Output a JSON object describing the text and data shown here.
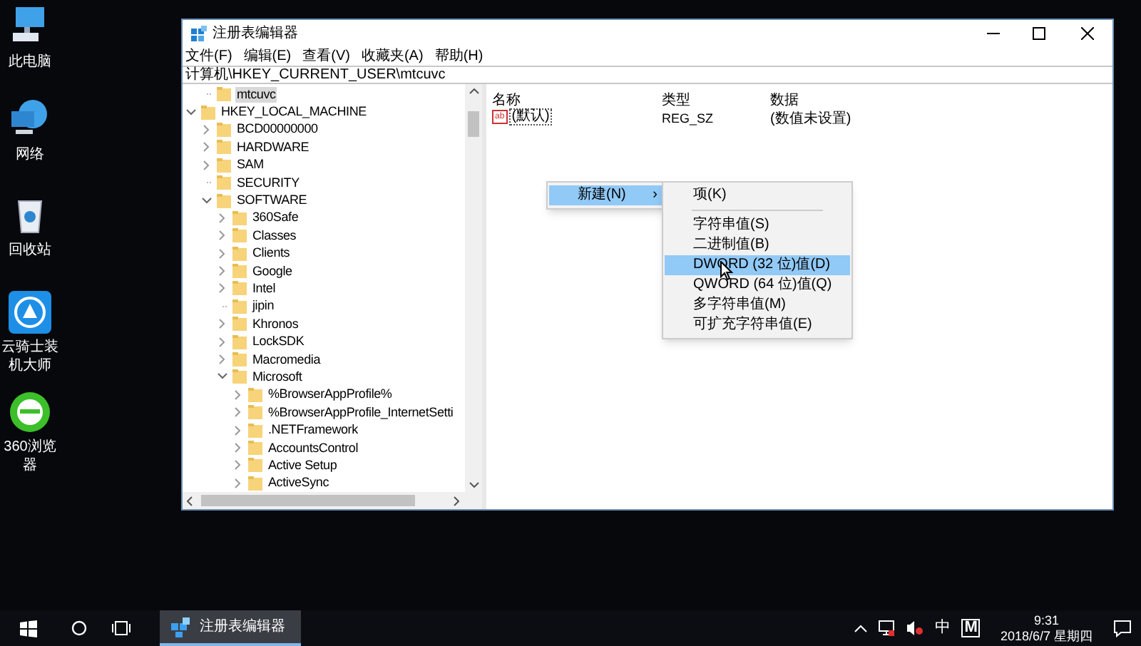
{
  "desktop_icons": [
    {
      "kind": "computer",
      "label": "此电脑"
    },
    {
      "kind": "network",
      "label": "网络"
    },
    {
      "kind": "recycle",
      "label": "回收站"
    },
    {
      "kind": "knight",
      "label": "云骑士装机大师"
    },
    {
      "kind": "browser",
      "label": "360浏览器"
    }
  ],
  "window": {
    "title": "注册表编辑器",
    "menu": [
      "文件(F)",
      "编辑(E)",
      "查看(V)",
      "收藏夹(A)",
      "帮助(H)"
    ],
    "address": "计算机\\HKEY_CURRENT_USER\\mtcuvc",
    "tree": [
      {
        "children": [
          {
            "label": "mtcuvc",
            "leaf": true,
            "selected": true
          }
        ]
      },
      {
        "label": "HKEY_LOCAL_MACHINE",
        "leaf": false,
        "expanded": true,
        "selected": false,
        "children": [
          {
            "label": "BCD00000000",
            "leaf": false,
            "expanded": false,
            "selected": false
          },
          {
            "label": "HARDWARE",
            "leaf": false,
            "expanded": false,
            "selected": false
          },
          {
            "label": "SAM",
            "leaf": false,
            "expanded": false,
            "selected": false
          },
          {
            "label": "SECURITY",
            "leaf": true,
            "selected": false
          },
          {
            "label": "SOFTWARE",
            "leaf": false,
            "expanded": true,
            "selected": false,
            "children": [
              {
                "label": "360Safe",
                "leaf": false,
                "expanded": false,
                "selected": false
              },
              {
                "label": "Classes",
                "leaf": false,
                "expanded": false,
                "selected": false
              },
              {
                "label": "Clients",
                "leaf": false,
                "expanded": false,
                "selected": false
              },
              {
                "label": "Google",
                "leaf": false,
                "expanded": false,
                "selected": false
              },
              {
                "label": "Intel",
                "leaf": false,
                "expanded": false,
                "selected": false
              },
              {
                "label": "jipin",
                "leaf": true,
                "selected": false
              },
              {
                "label": "Khronos",
                "leaf": false,
                "expanded": false,
                "selected": false
              },
              {
                "label": "LockSDK",
                "leaf": false,
                "expanded": false,
                "selected": false
              },
              {
                "label": "Macromedia",
                "leaf": false,
                "expanded": false,
                "selected": false
              },
              {
                "label": "Microsoft",
                "leaf": false,
                "expanded": true,
                "selected": false,
                "children": [
                  {
                    "label": "%BrowserAppProfile%",
                    "leaf": false,
                    "expanded": false,
                    "selected": false
                  },
                  {
                    "label": "%BrowserAppProfile_InternetSetti",
                    "leaf": false,
                    "expanded": false,
                    "selected": false
                  },
                  {
                    "label": ".NETFramework",
                    "leaf": false,
                    "expanded": false,
                    "selected": false
                  },
                  {
                    "label": "AccountsControl",
                    "leaf": false,
                    "expanded": false,
                    "selected": false
                  },
                  {
                    "label": "Active Setup",
                    "leaf": false,
                    "expanded": false,
                    "selected": false
                  },
                  {
                    "label": "ActiveSync",
                    "leaf": false,
                    "expanded": false,
                    "selected": false
                  }
                ]
              }
            ]
          }
        ]
      }
    ],
    "list": {
      "columns": [
        "名称",
        "类型",
        "数据"
      ],
      "rows": [
        {
          "icon_text": "ab",
          "name": "(默认)",
          "type": "REG_SZ",
          "data": "(数值未设置)"
        }
      ]
    },
    "context_menu": {
      "items": [
        {
          "label": "新建(N)",
          "arrow": "›",
          "selected": true
        }
      ]
    },
    "submenu": {
      "items": [
        {
          "kind": "item",
          "label": "项(K)",
          "selected": false
        },
        {
          "kind": "separator"
        },
        {
          "kind": "item",
          "label": "字符串值(S)",
          "selected": false
        },
        {
          "kind": "item",
          "label": "二进制值(B)",
          "selected": false
        },
        {
          "kind": "item",
          "label": "DWORD (32 位)值(D)",
          "selected": true
        },
        {
          "kind": "item",
          "label": "QWORD (64 位)值(Q)",
          "selected": false
        },
        {
          "kind": "item",
          "label": "多字符串值(M)",
          "selected": false
        },
        {
          "kind": "item",
          "label": "可扩充字符串值(E)",
          "selected": false
        }
      ]
    }
  },
  "taskbar": {
    "apps": [
      {
        "label": "注册表编辑器",
        "selected": true
      }
    ],
    "tray": {
      "ime": "中",
      "ime_mode": "M",
      "time": "9:31",
      "date": "2018/6/7 星期四"
    }
  }
}
